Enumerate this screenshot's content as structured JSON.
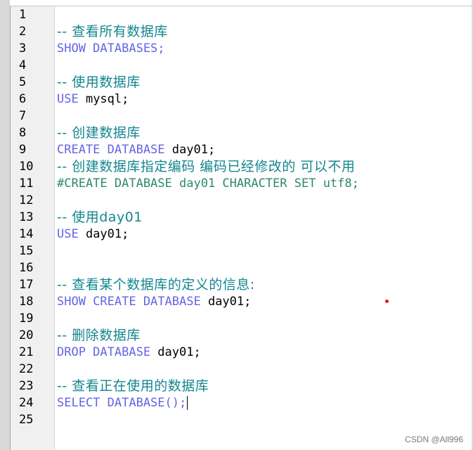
{
  "editor": {
    "lines": [
      {
        "num": "1",
        "parts": []
      },
      {
        "num": "2",
        "parts": [
          {
            "t": "-- 查看所有数据库",
            "c": "cm"
          }
        ]
      },
      {
        "num": "3",
        "parts": [
          {
            "t": "SHOW DATABASES;",
            "c": "kw"
          }
        ]
      },
      {
        "num": "4",
        "parts": []
      },
      {
        "num": "5",
        "parts": [
          {
            "t": "-- 使用数据库",
            "c": "cm"
          }
        ]
      },
      {
        "num": "6",
        "parts": [
          {
            "t": "USE ",
            "c": "kw"
          },
          {
            "t": "mysql;",
            "c": "id"
          }
        ]
      },
      {
        "num": "7",
        "parts": []
      },
      {
        "num": "8",
        "parts": [
          {
            "t": "-- 创建数据库",
            "c": "cm"
          }
        ]
      },
      {
        "num": "9",
        "parts": [
          {
            "t": "CREATE DATABASE ",
            "c": "kw"
          },
          {
            "t": "day01;",
            "c": "id"
          }
        ]
      },
      {
        "num": "10",
        "parts": [
          {
            "t": "-- 创建数据库指定编码 编码已经修改的 可以不用",
            "c": "cm"
          }
        ]
      },
      {
        "num": "11",
        "parts": [
          {
            "t": "#CREATE DATABASE day01 CHARACTER SET utf8;",
            "c": "pp"
          }
        ]
      },
      {
        "num": "12",
        "parts": []
      },
      {
        "num": "13",
        "parts": [
          {
            "t": "-- 使用day01",
            "c": "cm"
          }
        ]
      },
      {
        "num": "14",
        "parts": [
          {
            "t": "USE ",
            "c": "kw"
          },
          {
            "t": "day01;",
            "c": "id"
          }
        ]
      },
      {
        "num": "15",
        "parts": []
      },
      {
        "num": "16",
        "parts": []
      },
      {
        "num": "17",
        "parts": [
          {
            "t": "-- 查看某个数据库的定义的信息:",
            "c": "cm"
          }
        ]
      },
      {
        "num": "18",
        "parts": [
          {
            "t": "SHOW CREATE DATABASE ",
            "c": "kw"
          },
          {
            "t": "day01;",
            "c": "id"
          }
        ]
      },
      {
        "num": "19",
        "parts": []
      },
      {
        "num": "20",
        "parts": [
          {
            "t": "-- 删除数据库",
            "c": "cm"
          }
        ]
      },
      {
        "num": "21",
        "parts": [
          {
            "t": "DROP DATABASE ",
            "c": "kw"
          },
          {
            "t": "day01;",
            "c": "id"
          }
        ]
      },
      {
        "num": "22",
        "parts": []
      },
      {
        "num": "23",
        "parts": [
          {
            "t": "-- 查看正在使用的数据库",
            "c": "cm"
          }
        ]
      },
      {
        "num": "24",
        "parts": [
          {
            "t": "SELECT DATABASE();",
            "c": "kw"
          }
        ],
        "cursor": true
      },
      {
        "num": "25",
        "parts": []
      }
    ]
  },
  "colors": {
    "keyword": "#6464e6",
    "comment": "#13868f",
    "identifier": "#000000",
    "hash_comment": "#2a8a6e"
  },
  "watermark": "CSDN @All996"
}
